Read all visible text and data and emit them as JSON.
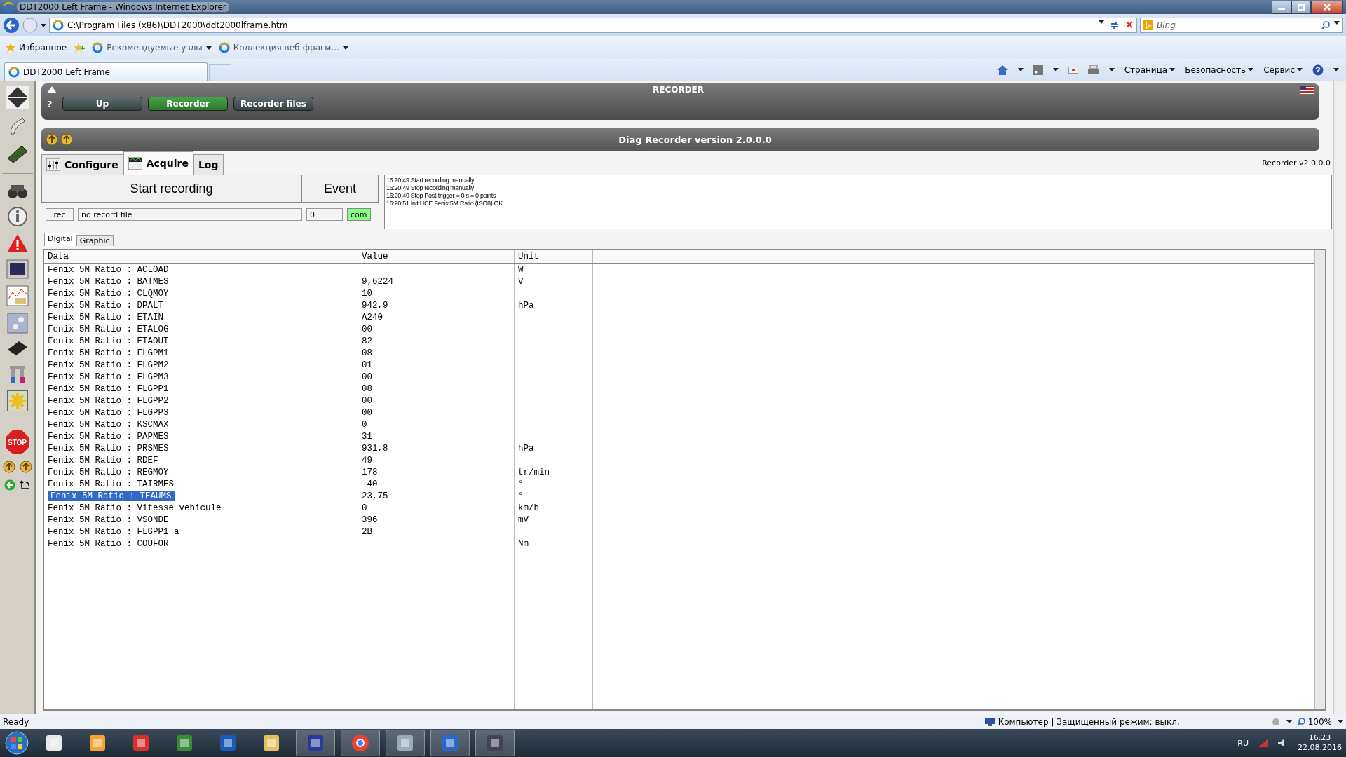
{
  "browser": {
    "title": "DDT2000 Left Frame - Windows Internet Explorer",
    "address": "C:\\Program Files (x86)\\DDT2000\\ddt2000lframe.htm",
    "search_placeholder": "Bing",
    "favorites_label": "Избранное",
    "favorite_links": [
      "Рекомендуемые узлы",
      "Коллекция веб-фрагм..."
    ],
    "tab_title": "DDT2000 Left Frame",
    "commands": [
      "Страница",
      "Безопасность",
      "Сервис"
    ]
  },
  "recorder": {
    "title": "RECORDER",
    "help": "?",
    "nav_buttons": [
      {
        "label": "Up",
        "selected": false
      },
      {
        "label": "Recorder",
        "selected": true
      },
      {
        "label": "Recorder files",
        "selected": false
      }
    ],
    "header_title": "Diag Recorder version 2.0.0.0",
    "tabs": [
      {
        "label": "Configure",
        "selected": false
      },
      {
        "label": "Acquire",
        "selected": true
      },
      {
        "label": "Log",
        "selected": false
      }
    ],
    "version_label": "Recorder v2.0.0.0",
    "start_button": "Start recording",
    "event_button": "Event",
    "log": [
      "16:20:49 Start recording manually",
      "16:20:49 Stop recording manually",
      "16:20:49 Stop Post-trigger = 0 s  = 0 points",
      "16:20:51 Init UCE Fenix 5M Ratio (ISO8) OK"
    ],
    "rec_label": "rec",
    "file_field": "no record file",
    "count_field": "0",
    "com_label": "com",
    "view_tabs": [
      {
        "label": "Digital",
        "selected": true
      },
      {
        "label": "Graphic",
        "selected": false
      }
    ],
    "table": {
      "columns": [
        "Data",
        "Value",
        "Unit"
      ],
      "rows": [
        {
          "data": "Fenix 5M Ratio : ACLOAD",
          "value": "",
          "unit": "W",
          "selected": false
        },
        {
          "data": "Fenix 5M Ratio : BATMES",
          "value": "9,6224",
          "unit": "V",
          "selected": false
        },
        {
          "data": "Fenix 5M Ratio : CLQMOY",
          "value": "10",
          "unit": "",
          "selected": false
        },
        {
          "data": "Fenix 5M Ratio : DPALT",
          "value": "942,9",
          "unit": "hPa",
          "selected": false
        },
        {
          "data": "Fenix 5M Ratio : ETAIN",
          "value": "A240",
          "unit": "",
          "selected": false
        },
        {
          "data": "Fenix 5M Ratio : ETALOG",
          "value": "00",
          "unit": "",
          "selected": false
        },
        {
          "data": "Fenix 5M Ratio : ETAOUT",
          "value": "82",
          "unit": "",
          "selected": false
        },
        {
          "data": "Fenix 5M Ratio : FLGPM1",
          "value": "08",
          "unit": "",
          "selected": false
        },
        {
          "data": "Fenix 5M Ratio : FLGPM2",
          "value": "01",
          "unit": "",
          "selected": false
        },
        {
          "data": "Fenix 5M Ratio : FLGPM3",
          "value": "00",
          "unit": "",
          "selected": false
        },
        {
          "data": "Fenix 5M Ratio : FLGPP1",
          "value": "08",
          "unit": "",
          "selected": false
        },
        {
          "data": "Fenix 5M Ratio : FLGPP2",
          "value": "00",
          "unit": "",
          "selected": false
        },
        {
          "data": "Fenix 5M Ratio : FLGPP3",
          "value": "00",
          "unit": "",
          "selected": false
        },
        {
          "data": "Fenix 5M Ratio : KSCMAX",
          "value": "0",
          "unit": "",
          "selected": false
        },
        {
          "data": "Fenix 5M Ratio : PAPMES",
          "value": "31",
          "unit": "",
          "selected": false
        },
        {
          "data": "Fenix 5M Ratio : PRSMES",
          "value": "931,8",
          "unit": "hPa",
          "selected": false
        },
        {
          "data": "Fenix 5M Ratio : RDEF",
          "value": "49",
          "unit": "",
          "selected": false
        },
        {
          "data": "Fenix 5M Ratio : REGMOY",
          "value": "178",
          "unit": "tr/min",
          "selected": false
        },
        {
          "data": "Fenix 5M Ratio : TAIRMES",
          "value": "-40",
          "unit": "°",
          "selected": false
        },
        {
          "data": "Fenix 5M Ratio : TEAUMS",
          "value": "23,75",
          "unit": "°",
          "selected": true
        },
        {
          "data": "Fenix 5M Ratio : Vitesse vehicule",
          "value": "0",
          "unit": "km/h",
          "selected": false
        },
        {
          "data": "Fenix 5M Ratio : VSONDE",
          "value": "396",
          "unit": "mV",
          "selected": false
        },
        {
          "data": "Fenix 5M Ratio : FLGPP1 a",
          "value": "2B",
          "unit": "",
          "selected": false
        },
        {
          "data": "Fenix 5M Ratio : COUFOR",
          "value": "",
          "unit": "Nm",
          "selected": false
        }
      ]
    }
  },
  "stop_button": "STOP",
  "status_bar": {
    "text": "Ready",
    "zone": "Компьютер | Защищенный режим: выкл.",
    "zoom": "100%"
  },
  "taskbar": {
    "language": "RU",
    "time": "16:23",
    "date": "22.08.2016"
  }
}
